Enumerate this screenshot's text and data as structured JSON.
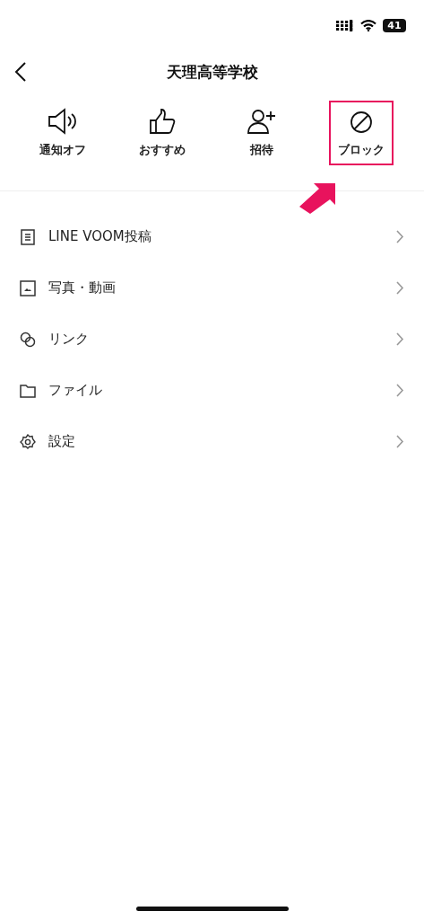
{
  "status_bar": {
    "battery": "41"
  },
  "header": {
    "title": "天理高等学校"
  },
  "actions": [
    {
      "kind": "speaker",
      "label": "通知オフ",
      "highlighted": false
    },
    {
      "kind": "thumb",
      "label": "おすすめ",
      "highlighted": false
    },
    {
      "kind": "invite",
      "label": "招待",
      "highlighted": false
    },
    {
      "kind": "block",
      "label": "ブロック",
      "highlighted": true
    }
  ],
  "menu": [
    {
      "kind": "post",
      "label": "LINE VOOM投稿"
    },
    {
      "kind": "photo",
      "label": "写真・動画"
    },
    {
      "kind": "link",
      "label": "リンク"
    },
    {
      "kind": "folder",
      "label": "ファイル"
    },
    {
      "kind": "gear",
      "label": "設定"
    }
  ]
}
